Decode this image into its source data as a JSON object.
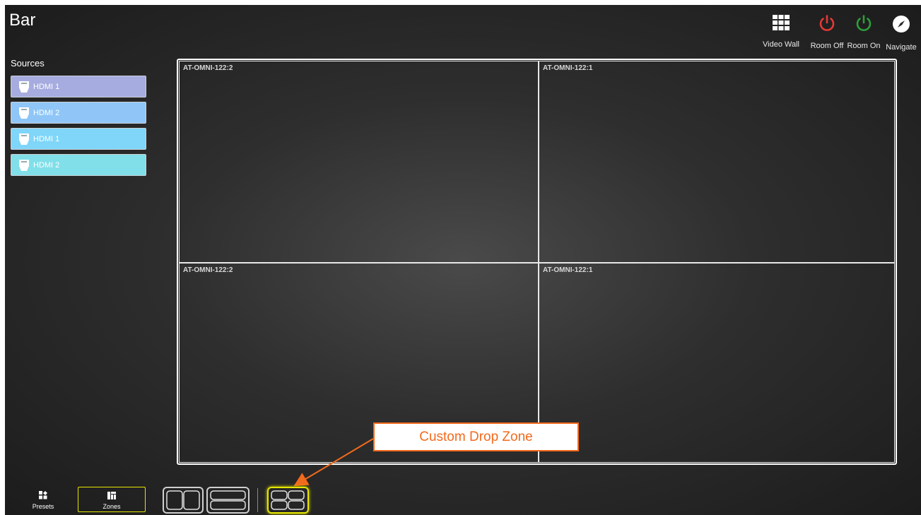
{
  "app": {
    "title": "Bar"
  },
  "top_actions": [
    {
      "label": "Video Wall",
      "icon": "grid-icon",
      "color": "#ffffff"
    },
    {
      "label": "Room Off",
      "icon": "power-icon",
      "color": "#e53935"
    },
    {
      "label": "Room On",
      "icon": "power-icon",
      "color": "#2e9e3a"
    },
    {
      "label": "Navigate",
      "icon": "compass-icon",
      "color": "#ffffff"
    }
  ],
  "sources": {
    "title": "Sources",
    "items": [
      {
        "label": "HDMI 1",
        "color": "#a6acdf"
      },
      {
        "label": "HDMI 2",
        "color": "#8fc6f7"
      },
      {
        "label": "HDMI 1",
        "color": "#7fd6f9"
      },
      {
        "label": "HDMI 2",
        "color": "#80dfe8"
      }
    ]
  },
  "wall": {
    "zones": [
      {
        "label": "AT-OMNI-122:2"
      },
      {
        "label": "AT-OMNI-122:1"
      },
      {
        "label": "AT-OMNI-122:2"
      },
      {
        "label": "AT-OMNI-122:1"
      }
    ]
  },
  "annotation": {
    "text": "Custom Drop Zone",
    "color": "#f26a1c"
  },
  "bottom_bar": {
    "presets_label": "Presets",
    "zones_label": "Zones",
    "active_color": "#e6e600",
    "layouts": [
      "two-columns-layout",
      "two-rows-layout",
      "quad-layout"
    ]
  }
}
